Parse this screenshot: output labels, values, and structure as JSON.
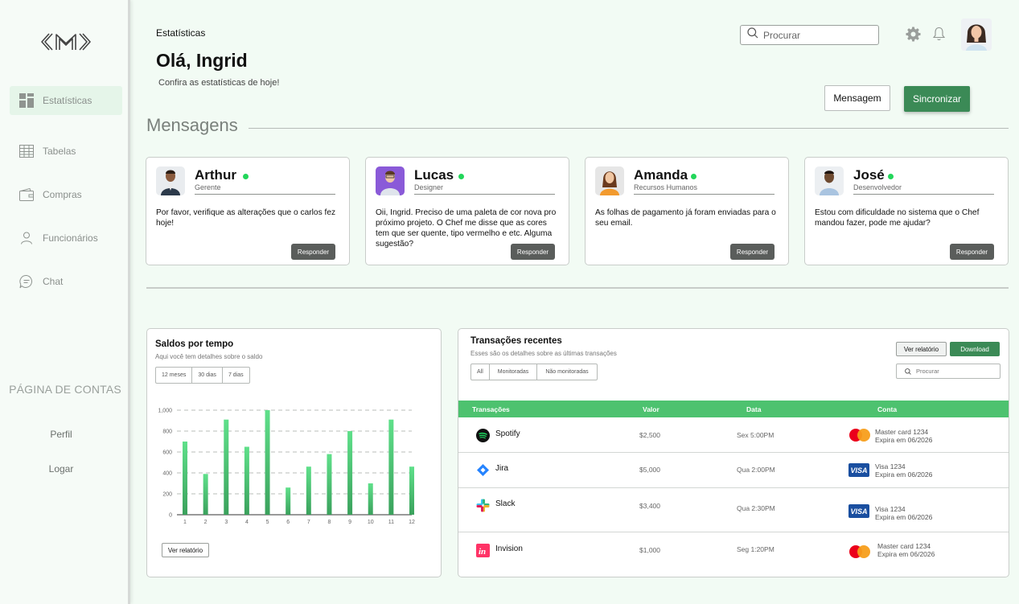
{
  "sidebar": {
    "items": [
      {
        "label": "Estatísticas",
        "icon": "grid-icon",
        "active": true
      },
      {
        "label": "Tabelas",
        "icon": "table-icon"
      },
      {
        "label": "Compras",
        "icon": "wallet-icon"
      },
      {
        "label": "Funcionários",
        "icon": "user-icon"
      },
      {
        "label": "Chat",
        "icon": "chat-icon"
      }
    ],
    "section_title": "PÁGINA DE CONTAS",
    "links": [
      {
        "label": "Perfil"
      },
      {
        "label": "Logar"
      }
    ]
  },
  "header": {
    "breadcrumb": "Estatísticas",
    "greeting": "Olá, Ingrid",
    "subtitle": "Confira as estatísticas de hoje!",
    "search_placeholder": "Procurar",
    "message_button": "Mensagem",
    "sync_button": "Sincronizar"
  },
  "messages": {
    "title": "Mensagens",
    "reply_label": "Responder",
    "cards": [
      {
        "name": "Arthur",
        "role": "Gerente",
        "text": "Por favor, verifique as alterações que o carlos fez hoje!",
        "online": true
      },
      {
        "name": "Lucas",
        "role": "Designer",
        "text": "Oii, Ingrid. Preciso de uma paleta de cor nova pro próximo projeto. O Chef me disse que as cores tem que ser quente, tipo vermelho e etc. Alguma sugestão?",
        "online": true
      },
      {
        "name": "Amanda",
        "role": "Recursos Humanos",
        "text": "As folhas de pagamento já foram enviadas para o seu email.",
        "online": true
      },
      {
        "name": "José",
        "role": "Desenvolvedor",
        "text": "Estou com dificuldade no sistema que o Chef mandou fazer, pode me ajudar?",
        "online": true
      }
    ]
  },
  "balance": {
    "title": "Saldos por tempo",
    "subtitle": "Aqui você tem detalhes sobre o saldo",
    "ranges": [
      "12 meses",
      "30 dias",
      "7 dias"
    ],
    "report_button": "Ver relatório"
  },
  "chart_data": {
    "type": "bar",
    "categories": [
      "1",
      "2",
      "3",
      "4",
      "5",
      "6",
      "7",
      "8",
      "9",
      "10",
      "11",
      "12"
    ],
    "values": [
      700,
      390,
      910,
      650,
      1000,
      260,
      460,
      580,
      800,
      300,
      910,
      460
    ],
    "yticks": [
      "0",
      "200",
      "400",
      "600",
      "800",
      "1,000"
    ],
    "ylim": [
      0,
      1000
    ],
    "grid": true,
    "bar_color": "#3aa15c"
  },
  "transactions": {
    "title": "Transações recentes",
    "subtitle": "Esses são os detalhes sobre as últimas transações",
    "filters": [
      "All",
      "Monitoradas",
      "Não monitoradas"
    ],
    "report_button": "Ver relatório",
    "download_button": "Download",
    "search_placeholder": "Procurar",
    "columns": [
      "Transações",
      "Valor",
      "Data",
      "Conta"
    ],
    "rows": [
      {
        "app": "Spotify",
        "value": "$2,500",
        "date": "Sex 5:00PM",
        "card_brand": "mastercard",
        "card": "Master card 1234",
        "expiry": "Expira em 06/2026"
      },
      {
        "app": "Jira",
        "value": "$5,000",
        "date": "Qua 2:00PM",
        "card_brand": "visa",
        "card": "Visa 1234",
        "expiry": "Expira em 06/2026"
      },
      {
        "app": "Slack",
        "value": "$3,400",
        "date": "Qua 2:30PM",
        "card_brand": "visa",
        "card": "Visa 1234",
        "expiry": "Expira em 06/2026"
      },
      {
        "app": "Invision",
        "value": "$1,000",
        "date": "Seg 1:20PM",
        "card_brand": "mastercard",
        "card": "Master card 1234",
        "expiry": "Expira em 06/2026"
      }
    ],
    "visa_label": "VISA"
  },
  "colors": {
    "accent": "#3b8a56",
    "table_header": "#4dc26f",
    "online": "#22d65a"
  }
}
